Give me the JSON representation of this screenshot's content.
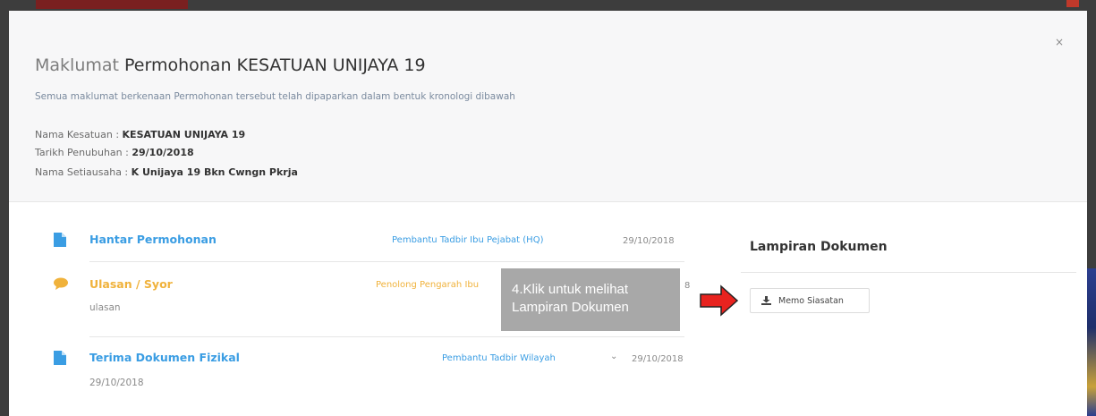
{
  "modal": {
    "close": "×",
    "title_prefix": "Maklumat",
    "title_main": "Permohonan KESATUAN UNIJAYA 19",
    "subtitle": "Semua maklumat berkenaan Permohonan tersebut telah dipaparkan dalam bentuk kronologi dibawah",
    "info": [
      {
        "label": "Nama Kesatuan : ",
        "value": "KESATUAN UNIJAYA 19"
      },
      {
        "label": "Tarikh Penubuhan : ",
        "value": "29/10/2018"
      },
      {
        "label": "Nama Setiausaha : ",
        "value": "K Unijaya 19 Bkn Cwngn Pkrja"
      }
    ]
  },
  "timeline": [
    {
      "title": "Hantar Permohonan",
      "by": "Pembantu Tadbir Ibu Pejabat (HQ)",
      "date": "29/10/2018",
      "icon": "document-icon",
      "color": "#3a9de3"
    },
    {
      "title": "Ulasan / Syor",
      "by": "Penolong Pengarah Ibu",
      "date": "8",
      "note": "ulasan",
      "icon": "comment-icon",
      "color": "#f0b23b"
    },
    {
      "title": "Terima Dokumen Fizikal",
      "by": "Pembantu Tadbir Wilayah",
      "date": "29/10/2018",
      "note": "29/10/2018",
      "icon": "document-icon",
      "chevron": "⌄",
      "color": "#3a9de3"
    }
  ],
  "tooltip": {
    "line1": "4.Klik untuk melihat",
    "line2": "Lampiran Dokumen"
  },
  "attachments": {
    "title": "Lampiran Dokumen",
    "button": "Memo Siasatan"
  }
}
